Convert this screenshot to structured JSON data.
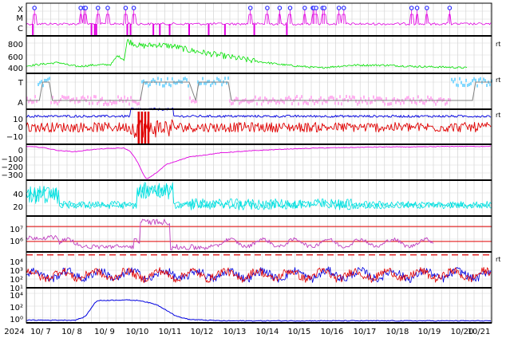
{
  "chart_data": {
    "type": "line",
    "x_ticks": [
      "2024",
      "10/ 7",
      "10/ 8",
      "10/ 9",
      "10/10",
      "10/11",
      "10/12",
      "10/13",
      "10/14",
      "10/15",
      "10/16",
      "10/17",
      "10/18",
      "10/19",
      "10/20",
      "10/21"
    ],
    "panels": [
      {
        "id": "flare",
        "y_tick_labels": [
          "X",
          "M",
          "C"
        ],
        "colors": {
          "line": "#e000e0",
          "marker": "#3030ff"
        },
        "markers_day": [
          0.25,
          1.67,
          1.78,
          1.82,
          2.2,
          2.5,
          3.05,
          3.3,
          6.88,
          7.4,
          7.78,
          8.1,
          8.55,
          8.8,
          8.83,
          8.9,
          9.1,
          9.15,
          9.6,
          9.75,
          11.83,
          12.0,
          12.3,
          13.0
        ]
      },
      {
        "id": "solar_wind_speed",
        "y_tick_labels": [
          "800",
          "600",
          "400"
        ],
        "colors": {
          "line": "#00e000"
        },
        "profile_day_kms": [
          [
            0,
            410
          ],
          [
            0.6,
            440
          ],
          [
            1.0,
            460
          ],
          [
            1.3,
            420
          ],
          [
            1.6,
            400
          ],
          [
            2.0,
            420
          ],
          [
            2.6,
            430
          ],
          [
            2.8,
            560
          ],
          [
            3.0,
            500
          ],
          [
            3.1,
            780
          ],
          [
            3.5,
            700
          ],
          [
            4.0,
            720
          ],
          [
            4.5,
            700
          ],
          [
            5.0,
            640
          ],
          [
            6.0,
            560
          ],
          [
            7.0,
            480
          ],
          [
            8.0,
            420
          ],
          [
            9.0,
            380
          ],
          [
            10.0,
            420
          ],
          [
            11.0,
            420
          ],
          [
            12.0,
            400
          ],
          [
            13.0,
            390
          ],
          [
            14.0,
            370
          ],
          [
            14.7,
            340
          ]
        ]
      },
      {
        "id": "imf_direction",
        "y_tick_labels": [
          "T",
          "A"
        ],
        "colors": {
          "toward": "#80d8ff",
          "away": "#ffb0f0",
          "line": "#808080"
        }
      },
      {
        "id": "imf_components",
        "y_tick_labels": [
          "10",
          "0",
          "−10"
        ],
        "colors": {
          "bt": "#0000e0",
          "bz": "#e00000"
        },
        "y_range": [
          -15,
          15
        ]
      },
      {
        "id": "dst",
        "y_tick_labels": [
          "0",
          "−100",
          "−200",
          "−300"
        ],
        "colors": {
          "line": "#e000e0"
        },
        "y_range": [
          -330,
          10
        ],
        "profile_day_nT": [
          [
            0,
            -10
          ],
          [
            0.5,
            -20
          ],
          [
            1.0,
            -50
          ],
          [
            1.5,
            -60
          ],
          [
            2.0,
            -40
          ],
          [
            2.5,
            -30
          ],
          [
            3.0,
            -25
          ],
          [
            3.2,
            -60
          ],
          [
            3.4,
            -150
          ],
          [
            3.6,
            -280
          ],
          [
            3.7,
            -320
          ],
          [
            4.0,
            -260
          ],
          [
            4.3,
            -180
          ],
          [
            5.0,
            -110
          ],
          [
            6.0,
            -70
          ],
          [
            7.0,
            -50
          ],
          [
            8.0,
            -35
          ],
          [
            9.0,
            -25
          ],
          [
            10.0,
            -20
          ],
          [
            11.0,
            -15
          ],
          [
            12.0,
            -15
          ],
          [
            13.0,
            -10
          ],
          [
            14.0,
            -10
          ],
          [
            14.7,
            -5
          ]
        ]
      },
      {
        "id": "ae_index",
        "y_tick_labels": [
          "40",
          "20"
        ],
        "colors": {
          "line": "#00e0e0"
        },
        "y_range": [
          0,
          60
        ]
      },
      {
        "id": "electron_flux",
        "y_tick_labels": [
          "10⁷",
          "10⁶"
        ],
        "colors": {
          "line": "#c040c0",
          "threshold": "#e00000"
        },
        "log_range": [
          5.3,
          7.7
        ],
        "thresholds_log": [
          7.0,
          6.0
        ]
      },
      {
        "id": "proton_flux",
        "y_tick_labels": [
          "10⁴",
          "10³",
          "10²",
          "10¹"
        ],
        "colors": {
          "blue": "#0000e0",
          "red": "#e00000",
          "threshold": "#e00000"
        },
        "log_range": [
          0.7,
          4.3
        ],
        "threshold_log": 4.0
      },
      {
        "id": "high_energy_proton",
        "y_tick_labels": [
          "10⁴",
          "10²",
          "10⁰"
        ],
        "colors": {
          "line": "#0000e0"
        },
        "log_range": [
          -0.7,
          4.5
        ],
        "profile_day_log": [
          [
            0,
            -0.3
          ],
          [
            1.5,
            -0.3
          ],
          [
            1.8,
            0.2
          ],
          [
            2.0,
            1.5
          ],
          [
            2.1,
            2.3
          ],
          [
            2.2,
            2.6
          ],
          [
            3.0,
            2.7
          ],
          [
            3.5,
            2.6
          ],
          [
            4.0,
            2.0
          ],
          [
            4.3,
            1.2
          ],
          [
            4.6,
            0.3
          ],
          [
            5.0,
            -0.2
          ],
          [
            6.0,
            -0.4
          ],
          [
            14.7,
            -0.4
          ]
        ]
      }
    ],
    "right_marks": [
      "rt",
      "rt",
      "rt",
      "rt"
    ]
  }
}
